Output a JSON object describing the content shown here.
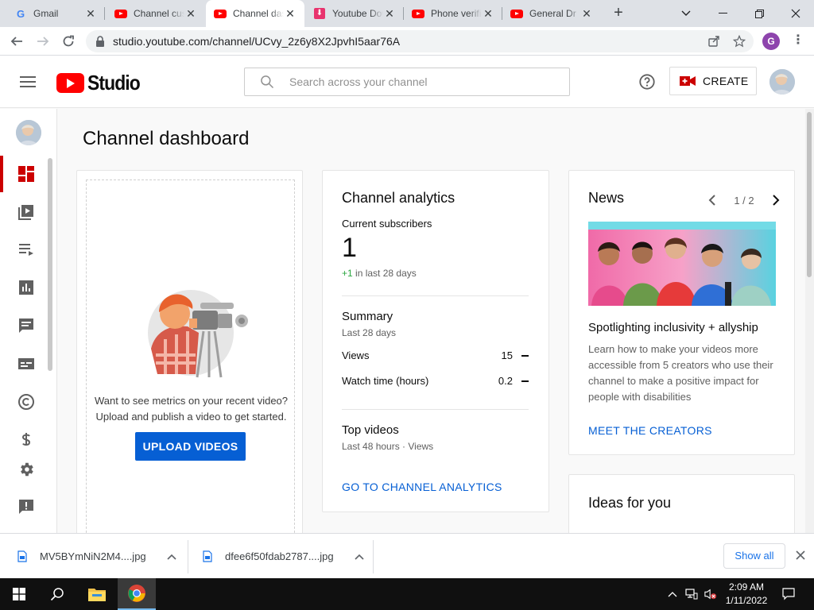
{
  "browser": {
    "tabs": [
      {
        "title": "Gmail",
        "favicon": "gmail-favicon"
      },
      {
        "title": "Channel customization",
        "favicon": "youtube-favicon"
      },
      {
        "title": "Channel dashboard",
        "favicon": "youtube-favicon",
        "active": true
      },
      {
        "title": "Youtube Downloader",
        "favicon": "download-favicon"
      },
      {
        "title": "Phone verification",
        "favicon": "youtube-favicon"
      },
      {
        "title": "General Dr",
        "favicon": "youtube-favicon"
      }
    ],
    "url": "studio.youtube.com/channel/UCvy_2z6y8X2JpvhI5aar76A",
    "profile_initial": "G"
  },
  "header": {
    "logo_text": "Studio",
    "search_placeholder": "Search across your channel",
    "create_label": "CREATE"
  },
  "page": {
    "title": "Channel dashboard"
  },
  "upload_card": {
    "text_line1": "Want to see metrics on your recent video?",
    "text_line2": "Upload and publish a video to get started.",
    "button_label": "UPLOAD VIDEOS"
  },
  "analytics": {
    "title": "Channel analytics",
    "subscribers_label": "Current subscribers",
    "subscribers_value": "1",
    "delta_value": "+1",
    "delta_text": "in last 28 days",
    "summary_title": "Summary",
    "summary_period": "Last 28 days",
    "metrics": [
      {
        "name": "Views",
        "value": "15"
      },
      {
        "name": "Watch time (hours)",
        "value": "0.2"
      }
    ],
    "top_videos_title": "Top videos",
    "top_videos_sub": "Last 48 hours · Views",
    "link_label": "GO TO CHANNEL ANALYTICS"
  },
  "news": {
    "title": "News",
    "pager": "1 / 2",
    "headline": "Spotlighting inclusivity + allyship",
    "body": "Learn how to make your videos more accessible from 5 creators who use their channel to make a positive impact for people with disabilities",
    "link_label": "MEET THE CREATORS"
  },
  "ideas": {
    "title": "Ideas for you"
  },
  "downloads": {
    "items": [
      {
        "name": "MV5BYmNiN2M4....jpg"
      },
      {
        "name": "dfee6f50fdab2787....jpg"
      }
    ],
    "show_all_label": "Show all"
  },
  "taskbar": {
    "time": "2:09 AM",
    "date": "1/11/2022"
  },
  "colors": {
    "accent_red": "#ff0000",
    "link_blue": "#065fd4",
    "positive_green": "#2ba640"
  }
}
